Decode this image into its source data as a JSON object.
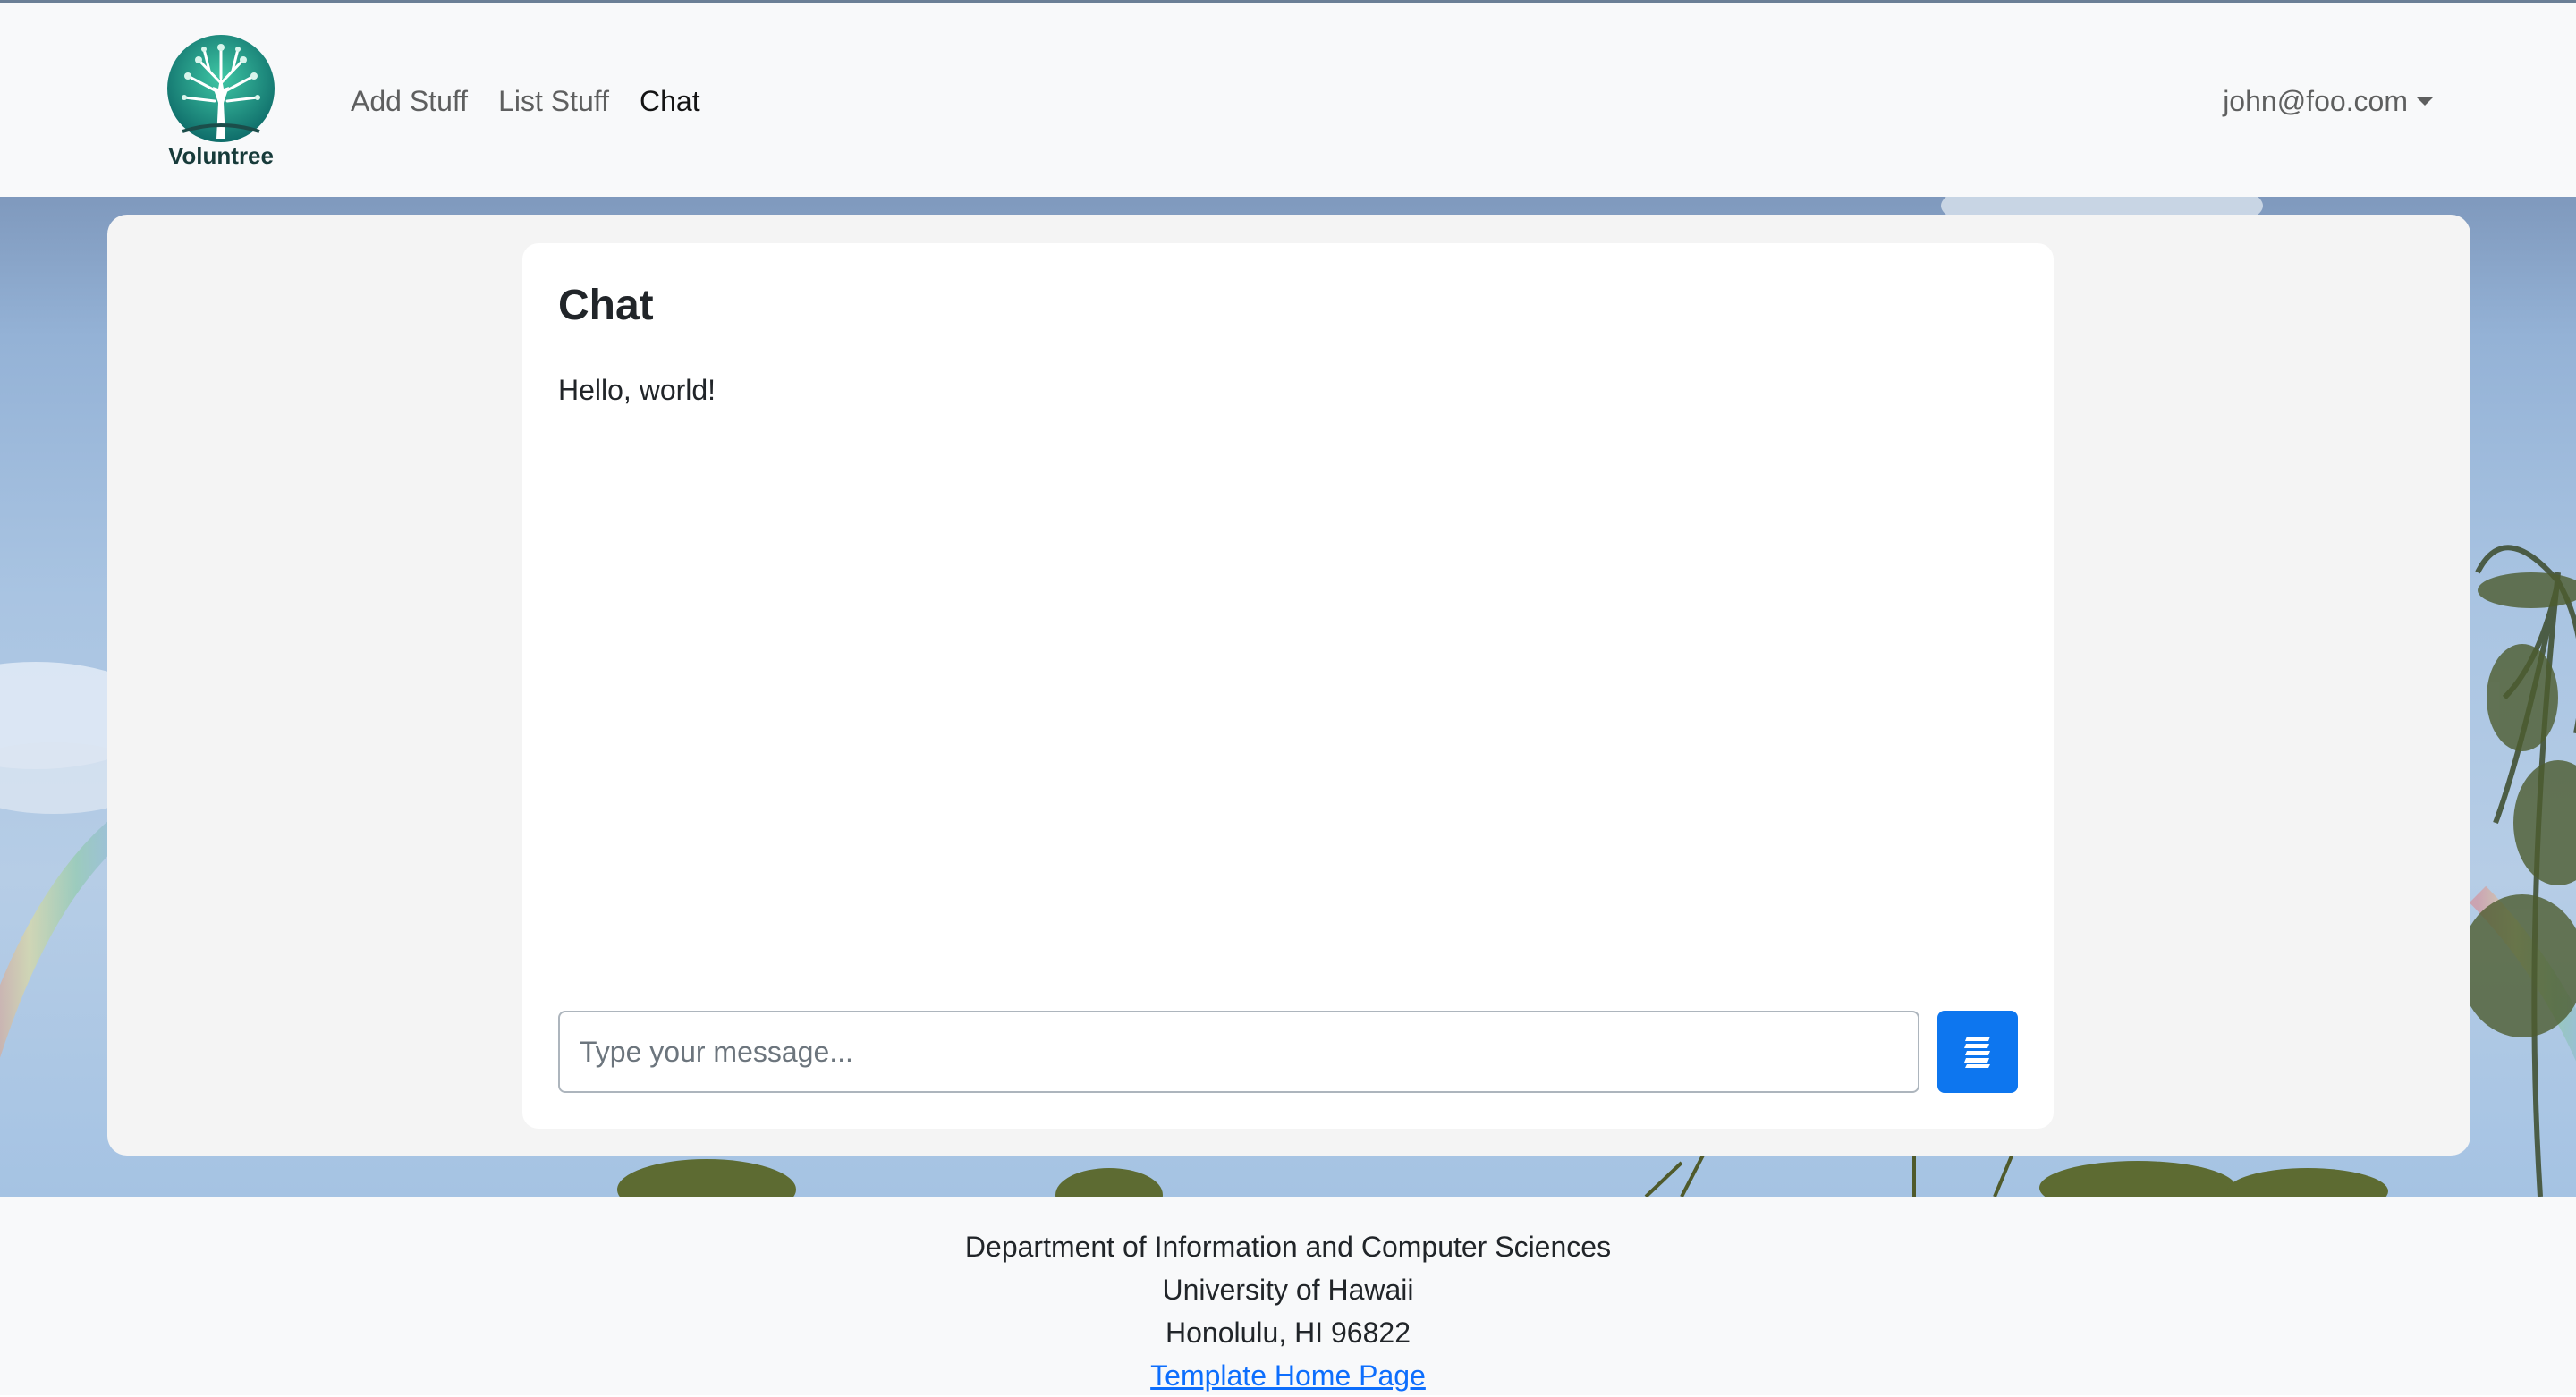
{
  "navbar": {
    "logo_text": "Voluntree",
    "links": [
      {
        "label": "Add Stuff",
        "active": false
      },
      {
        "label": "List Stuff",
        "active": false
      },
      {
        "label": "Chat",
        "active": true
      }
    ],
    "user_email": "john@foo.com"
  },
  "chat": {
    "title": "Chat",
    "messages": [
      "Hello, world!"
    ],
    "input_placeholder": "Type your message...",
    "input_value": "",
    "send_icon": "send-icon"
  },
  "footer": {
    "lines": [
      "Department of Information and Computer Sciences",
      "University of Hawaii",
      "Honolulu, HI 96822"
    ],
    "link_label": "Template Home Page"
  },
  "colors": {
    "accent": "#0d76ef",
    "navbar_bg": "#f8f9fa",
    "panel_bg": "#f4f4f4",
    "link": "#0d6efd"
  }
}
